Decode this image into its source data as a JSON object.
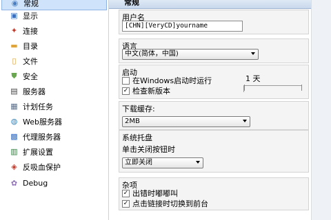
{
  "sidebar": {
    "items": [
      {
        "label": "常规",
        "icon": "general-icon",
        "glyph": "◉",
        "color": "#4a7fc1"
      },
      {
        "label": "显示",
        "icon": "display-icon",
        "glyph": "▣",
        "color": "#3a6fbf"
      },
      {
        "label": "连接",
        "icon": "connection-icon",
        "glyph": "✦",
        "color": "#c0392b"
      },
      {
        "label": "目录",
        "icon": "folder-icon",
        "glyph": "▬",
        "color": "#e0a53a"
      },
      {
        "label": "文件",
        "icon": "file-icon",
        "glyph": "▯",
        "color": "#d49a2a"
      },
      {
        "label": "安全",
        "icon": "shield-icon",
        "glyph": "⛊",
        "color": "#6aa84f"
      },
      {
        "label": "服务器",
        "icon": "server-icon",
        "glyph": "▤",
        "color": "#444444"
      },
      {
        "label": "计划任务",
        "icon": "calendar-icon",
        "glyph": "▦",
        "color": "#5b6f8a"
      },
      {
        "label": "Web服务器",
        "icon": "globe-icon",
        "glyph": "◍",
        "color": "#2e86c1"
      },
      {
        "label": "代理服务器",
        "icon": "proxy-icon",
        "glyph": "▩",
        "color": "#3a6fbf"
      },
      {
        "label": "扩展设置",
        "icon": "extension-icon",
        "glyph": "▥",
        "color": "#2c7a3a"
      },
      {
        "label": "反吸血保护",
        "icon": "protection-icon",
        "glyph": "◈",
        "color": "#c0392b"
      },
      {
        "label": "Debug",
        "icon": "debug-icon",
        "glyph": "✿",
        "color": "#8e6fb8"
      }
    ]
  },
  "header": {
    "title": "常规"
  },
  "username": {
    "title": "用户名",
    "value": "[CHN][VeryCD]yourname"
  },
  "language": {
    "title": "语言",
    "selected": "中文(简体，中国)"
  },
  "startup": {
    "title": "启动",
    "run_on_startup": "在Windows启动时运行",
    "check_updates": "检查新版本",
    "check_mark": "✓",
    "days_label": "1 天"
  },
  "download_cache": {
    "title": "下载缓存:",
    "selected": "2MB"
  },
  "tray": {
    "title": "系统托盘",
    "close_label": "单击关闭按钮时",
    "selected": "立即关闭"
  },
  "misc": {
    "title": "杂项",
    "beep_on_error": "出错时嘟嘟叫",
    "switch_foreground": "点击链接时切换到前台",
    "check_mark": "✓"
  },
  "colors": {
    "selected_bg": "#cfe3fb",
    "accent": "#8db2e3"
  }
}
